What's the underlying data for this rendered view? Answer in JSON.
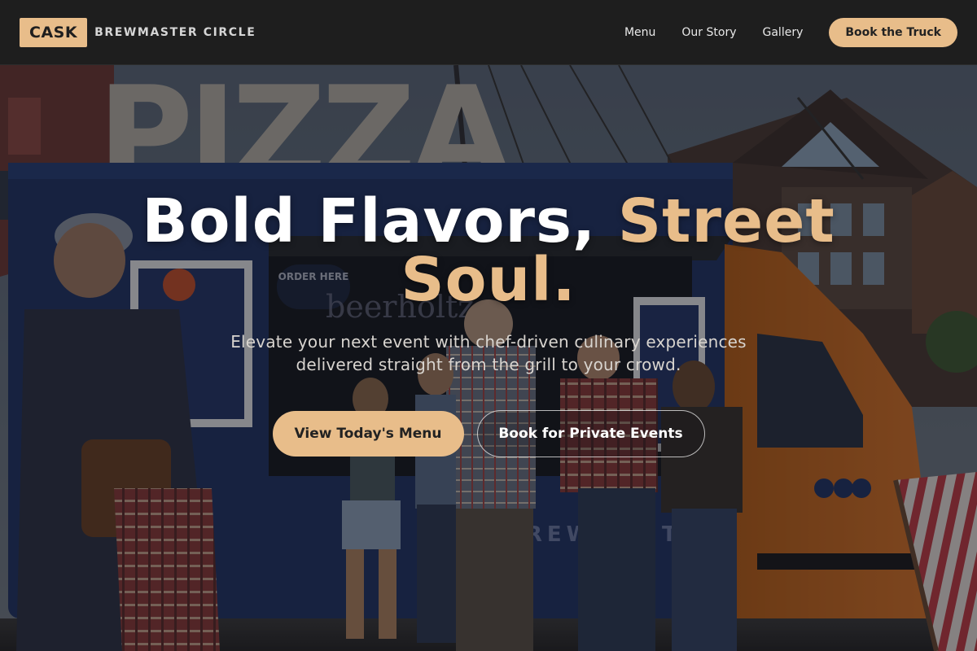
{
  "header": {
    "logo_badge": "CASK",
    "brand_name": "BREWMASTER CIRCLE",
    "nav": [
      "Menu",
      "Our Story",
      "Gallery"
    ],
    "cta_label": "Book the Truck"
  },
  "hero": {
    "headline_main": "Bold Flavors, ",
    "headline_accent": "Street Soul.",
    "subtitle": "Elevate your next event with chef-driven culinary experiences delivered straight from the grill to your crowd.",
    "primary_cta": "View Today's Menu",
    "secondary_cta": "Book for Private Events",
    "photo": {
      "sign_text": "PIZZA",
      "window_sign": "ORDER HERE",
      "truck_script": "beerholtz",
      "truck_lower_text": "BREWMASTER"
    }
  },
  "colors": {
    "accent": "#e8bd8a",
    "header_bg": "#1e1e1e",
    "truck_blue": "#1f3466",
    "truck_orange": "#c9671b"
  }
}
